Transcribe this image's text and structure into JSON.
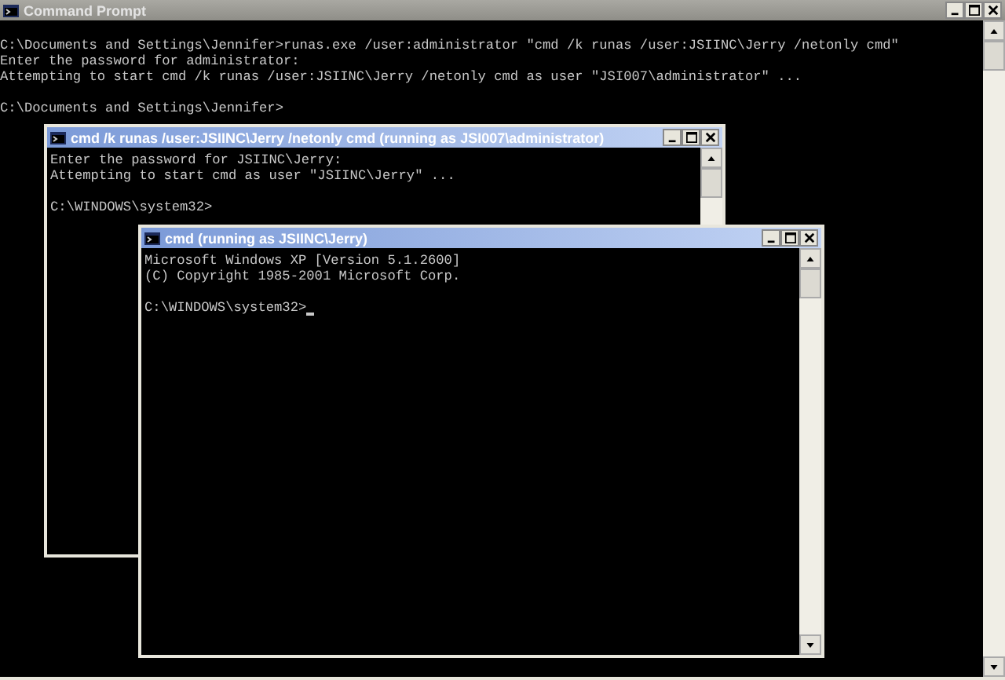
{
  "windows": [
    {
      "title": "Command Prompt",
      "cursor": false,
      "paragraphs": [
        [
          "C:\\Documents and Settings\\Jennifer>runas.exe /user:administrator \"cmd /k runas /user:JSIINC\\Jerry /netonly cmd\"",
          "Enter the password for administrator:",
          "Attempting to start cmd /k runas /user:JSIINC\\Jerry /netonly cmd as user \"JSI007\\administrator\" ..."
        ],
        [
          "C:\\Documents and Settings\\Jennifer>"
        ]
      ]
    },
    {
      "title": "cmd /k runas /user:JSIINC\\Jerry /netonly cmd (running as JSI007\\administrator)",
      "cursor": false,
      "paragraphs": [
        [
          "Enter the password for JSIINC\\Jerry:",
          "Attempting to start cmd as user \"JSIINC\\Jerry\" ..."
        ],
        [
          "C:\\WINDOWS\\system32>"
        ]
      ]
    },
    {
      "title": "cmd (running as JSIINC\\Jerry)",
      "cursor": true,
      "paragraphs": [
        [
          "Microsoft Windows XP [Version 5.1.2600]",
          "(C) Copyright 1985-2001 Microsoft Corp."
        ],
        [
          "C:\\WINDOWS\\system32>"
        ]
      ]
    }
  ]
}
